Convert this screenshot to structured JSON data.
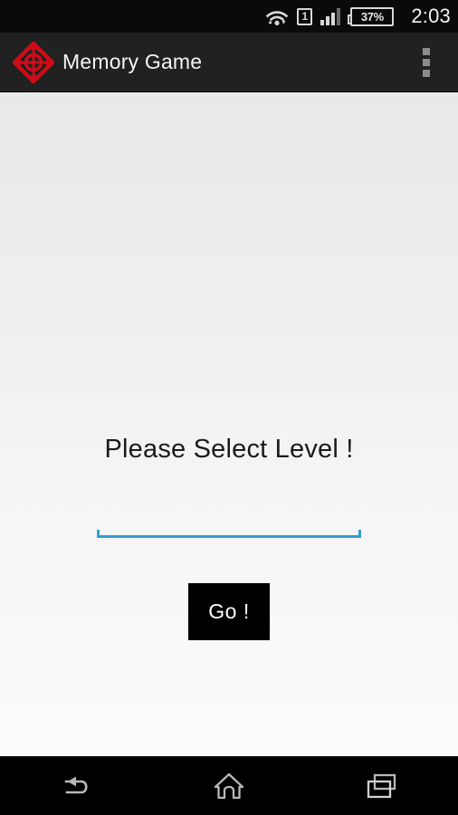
{
  "status_bar": {
    "wifi_icon": "wifi-transfer-icon",
    "sim_label": "1",
    "signal_icon": "cellular-signal-icon",
    "battery_text": "37%",
    "clock": "2:03"
  },
  "action_bar": {
    "app_icon": "compass-diamond-icon",
    "title": "Memory Game",
    "overflow_icon": "overflow-menu-icon"
  },
  "content": {
    "prompt": "Please Select Level !",
    "spinner": {
      "selected_value": "",
      "accent_color": "#2f9fd0"
    },
    "go_button": "Go !"
  },
  "nav_bar": {
    "back_icon": "back-arrow-icon",
    "home_icon": "home-icon",
    "recents_icon": "recent-apps-icon"
  }
}
